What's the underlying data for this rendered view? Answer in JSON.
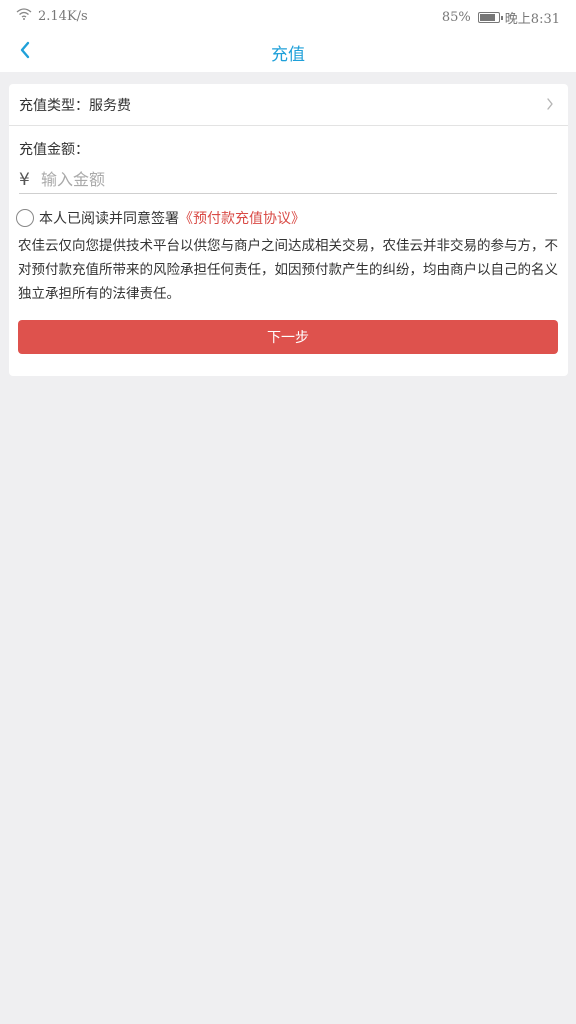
{
  "status_bar": {
    "network_speed": "2.14K/s",
    "battery_percent": "85%",
    "battery_level": 0.85,
    "time": "晚上8:31"
  },
  "nav": {
    "title": "充值"
  },
  "form": {
    "type_label": "充值类型：",
    "type_value": "服务费",
    "amount_label": "充值金额：",
    "currency_symbol": "¥",
    "amount_value": "",
    "amount_placeholder": "输入金额",
    "agree_text": "本人已阅读并同意签署",
    "agreement_link": "《预付款充值协议》",
    "disclaimer": "农佳云仅向您提供技术平台以供您与商户之间达成相关交易，农佳云并非交易的参与方，不对预付款充值所带来的风险承担任何责任，如因预付款产生的纠纷，均由商户以自己的名义独立承担所有的法律责任。",
    "next_button": "下一步"
  },
  "colors": {
    "accent": "#1fa0d9",
    "primary_button": "#de524d",
    "link": "#d94b46",
    "background": "#efeff1"
  }
}
